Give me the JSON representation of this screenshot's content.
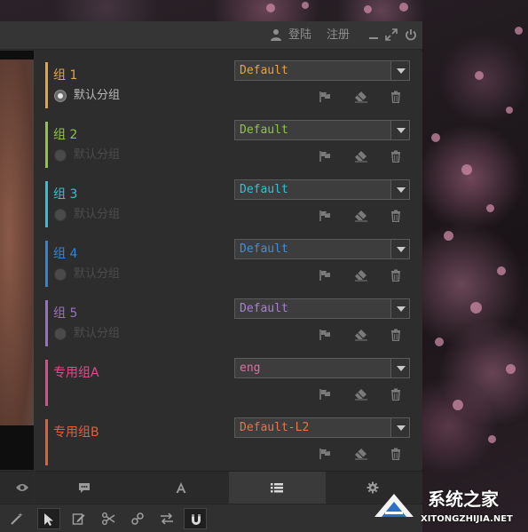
{
  "titlebar": {
    "login_label": "登陆",
    "register_label": "注册"
  },
  "groups": [
    {
      "title": "组 1",
      "radio_label": "默认分组",
      "radio_active": true,
      "select_value": "Default",
      "color": "#e8a33c",
      "select_color": "#e8a33c"
    },
    {
      "title": "组 2",
      "radio_label": "默认分组",
      "radio_active": false,
      "select_value": "Default",
      "color": "#8ec63f",
      "select_color": "#8ec63f"
    },
    {
      "title": "组 3",
      "radio_label": "默认分组",
      "radio_active": false,
      "select_value": "Default",
      "color": "#2ec3d6",
      "select_color": "#2ec3d6"
    },
    {
      "title": "组 4",
      "radio_label": "默认分组",
      "radio_active": false,
      "select_value": "Default",
      "color": "#2f86d8",
      "select_color": "#3d8fe0"
    },
    {
      "title": "组 5",
      "radio_label": "默认分组",
      "radio_active": false,
      "select_value": "Default",
      "color": "#9b6fc4",
      "select_color": "#a97fd0"
    },
    {
      "title": "专用组A",
      "radio_label": "",
      "radio_active": false,
      "select_value": "eng",
      "color": "#e24a8f",
      "select_color": "#e76aa3"
    },
    {
      "title": "专用组B",
      "radio_label": "",
      "radio_active": false,
      "select_value": "Default-L2",
      "color": "#e0603a",
      "select_color": "#e8744c"
    }
  ],
  "group_actions": [
    "flag-icon",
    "eraser-icon",
    "trash-icon"
  ],
  "tabs": [
    {
      "icon": "chat-bubble-icon",
      "active": false
    },
    {
      "icon": "font-a-icon",
      "active": false
    },
    {
      "icon": "list-icon",
      "active": true
    },
    {
      "icon": "gear-icon",
      "active": false
    }
  ],
  "toolbar": [
    "magic-wand-icon",
    "cursor-icon",
    "edit-icon",
    "scissors-icon",
    "link-icon",
    "swap-icon",
    "magnet-icon"
  ],
  "watermark": {
    "title": "系统之家",
    "url": "XITONGZHIJIA.NET"
  },
  "colors": {
    "panel_bg": "#2d2d2d",
    "titlebar_bg": "#353535",
    "muted_text": "#8e8e8e"
  }
}
